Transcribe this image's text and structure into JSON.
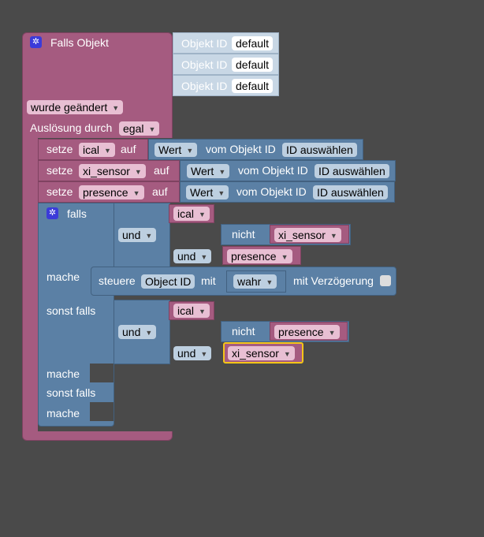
{
  "trigger": {
    "title": "Falls Objekt",
    "objekt_id_label": "Objekt ID",
    "objekt_ids": [
      "default",
      "default",
      "default"
    ],
    "changed": "wurde geändert",
    "ausloesung_label": "Auslösung durch",
    "ausloesung_value": "egal"
  },
  "setze": {
    "setze_label": "setze",
    "auf_label": "auf",
    "wert_label": "Wert",
    "vom_objekt_label": "vom Objekt ID",
    "id_placeholder": "ID auswählen",
    "vars": [
      "ical",
      "xi_sensor",
      "presence"
    ]
  },
  "ifblock": {
    "falls_label": "falls",
    "mache_label": "mache",
    "sonst_falls_label": "sonst falls",
    "und_label": "und",
    "nicht_label": "nicht",
    "cond1": {
      "a": "ical",
      "b": "xi_sensor",
      "c": "presence"
    },
    "cond2": {
      "a": "ical",
      "b": "presence",
      "c": "xi_sensor"
    },
    "steuere_label": "steuere",
    "objekt_id_field": "Object ID",
    "mit_label": "mit",
    "wahr_value": "wahr",
    "mit_verzoegerung_label": "mit Verzögerung"
  },
  "colors": {
    "event": "#a55b80",
    "logic": "#5b80a5",
    "selected": "#f5c518"
  }
}
